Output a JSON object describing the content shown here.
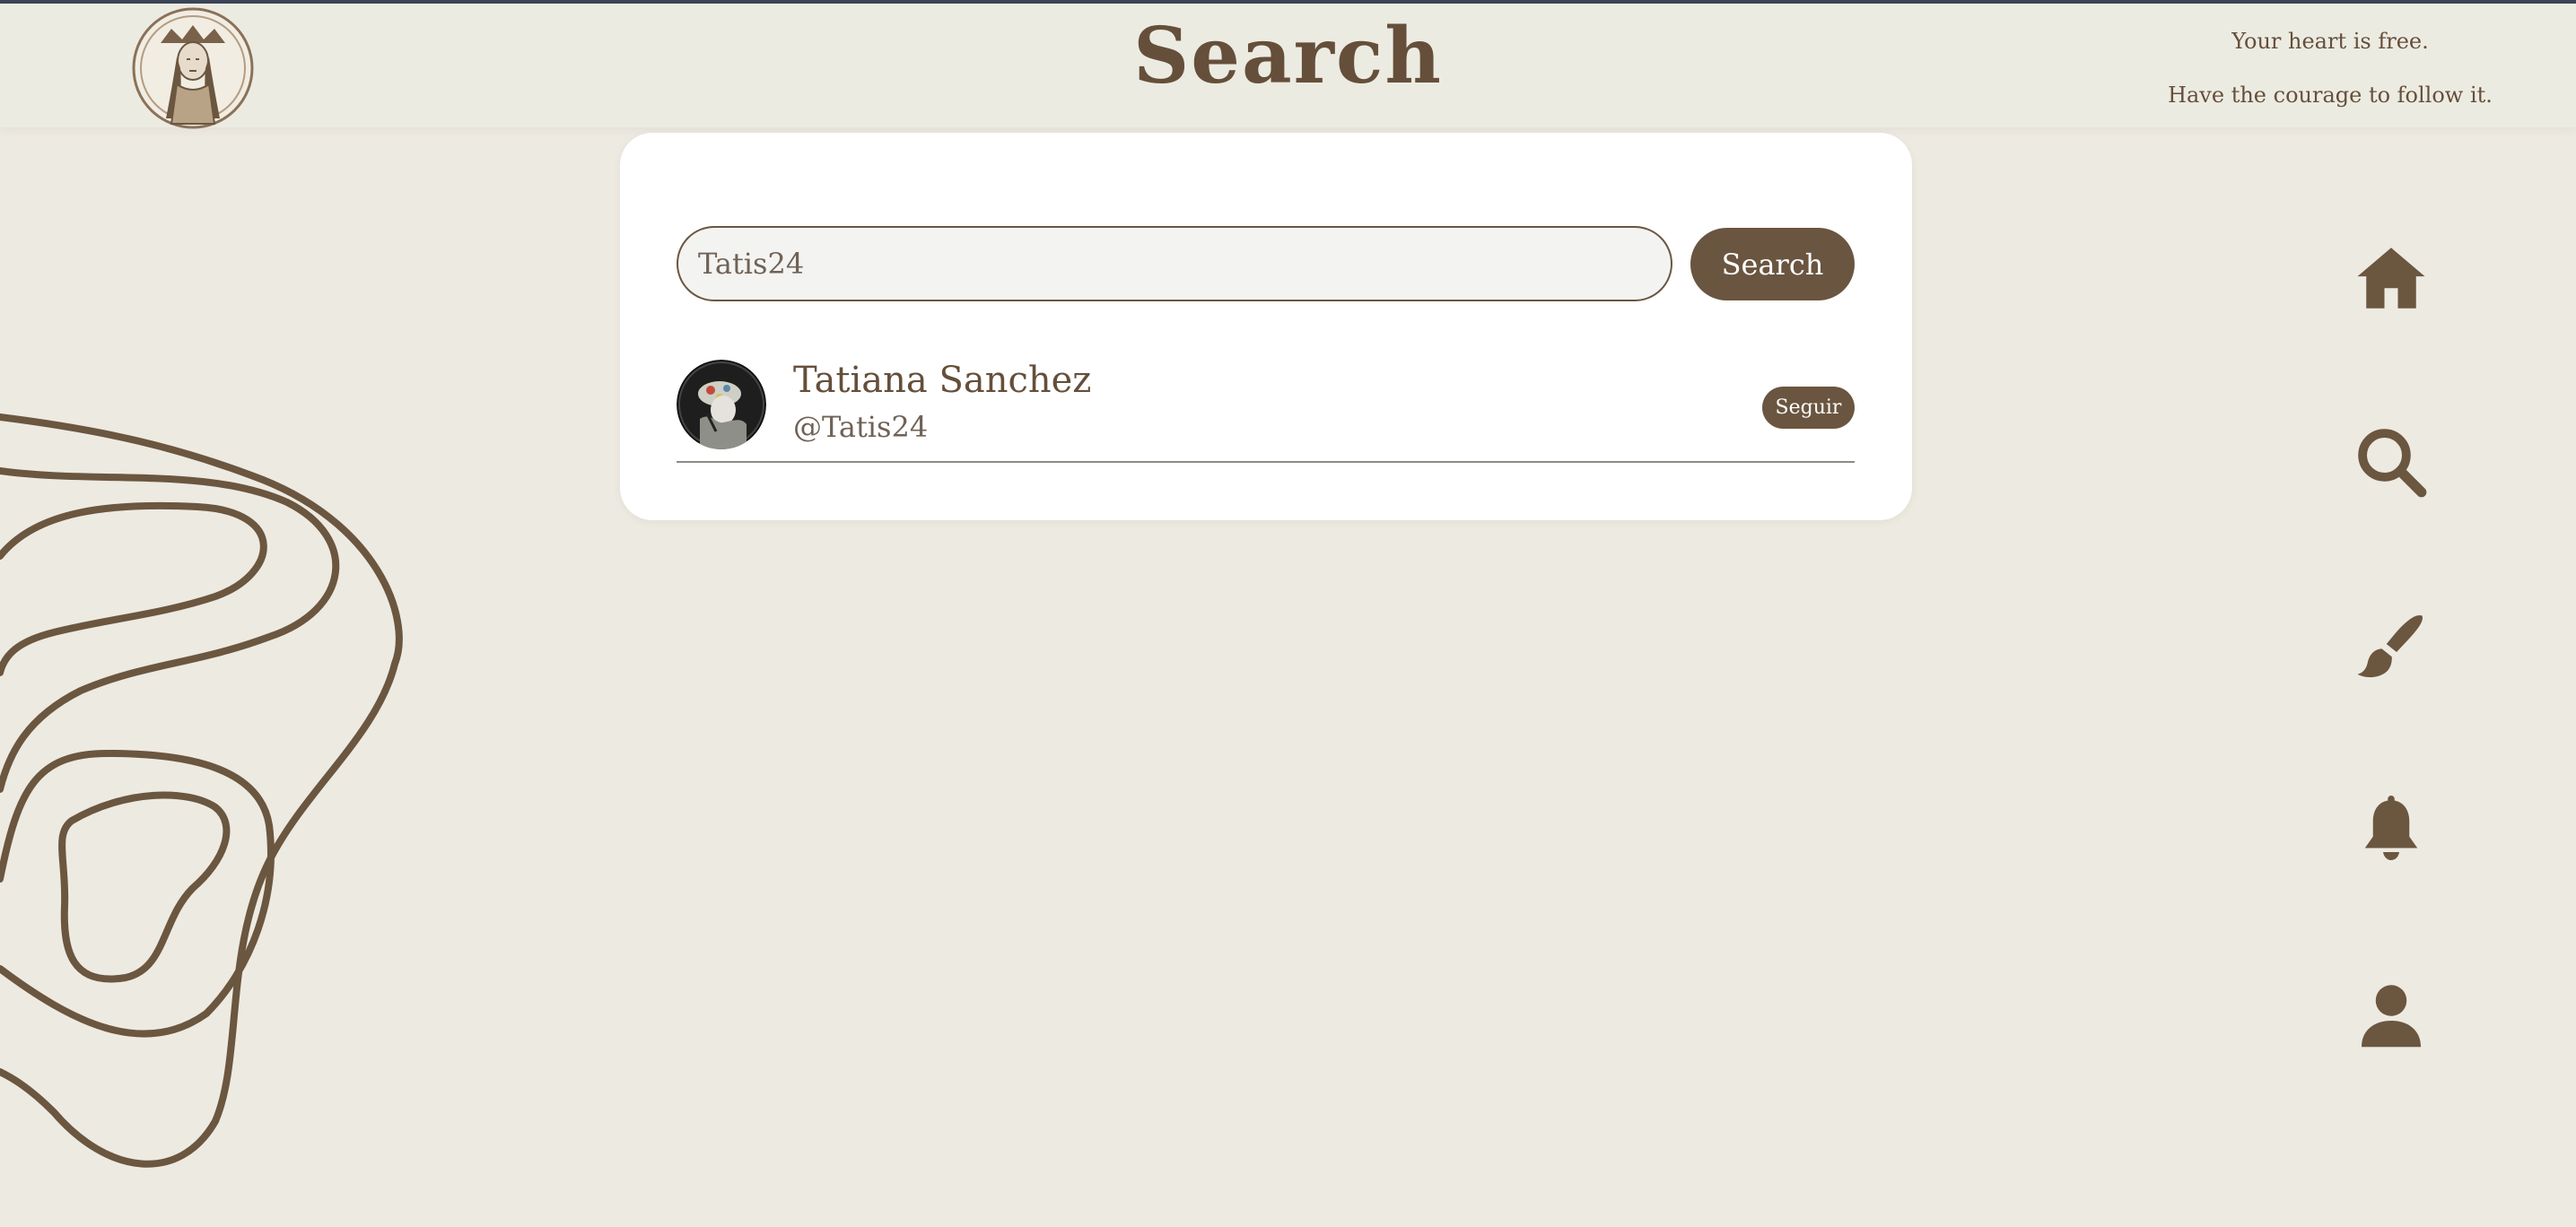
{
  "header": {
    "title": "Search",
    "quote_line1": "Your heart is free.",
    "quote_line2": "Have the courage to follow it."
  },
  "search": {
    "value": "Tatis24",
    "button_label": "Search"
  },
  "results": [
    {
      "name": "Tatiana Sanchez",
      "handle": "@Tatis24",
      "follow_label": "Seguir"
    }
  ],
  "nav": [
    "home-icon",
    "search-icon",
    "brush-icon",
    "bell-icon",
    "user-icon"
  ],
  "colors": {
    "background": "#edeae1",
    "accent": "#6a5540",
    "card": "#ffffff"
  }
}
